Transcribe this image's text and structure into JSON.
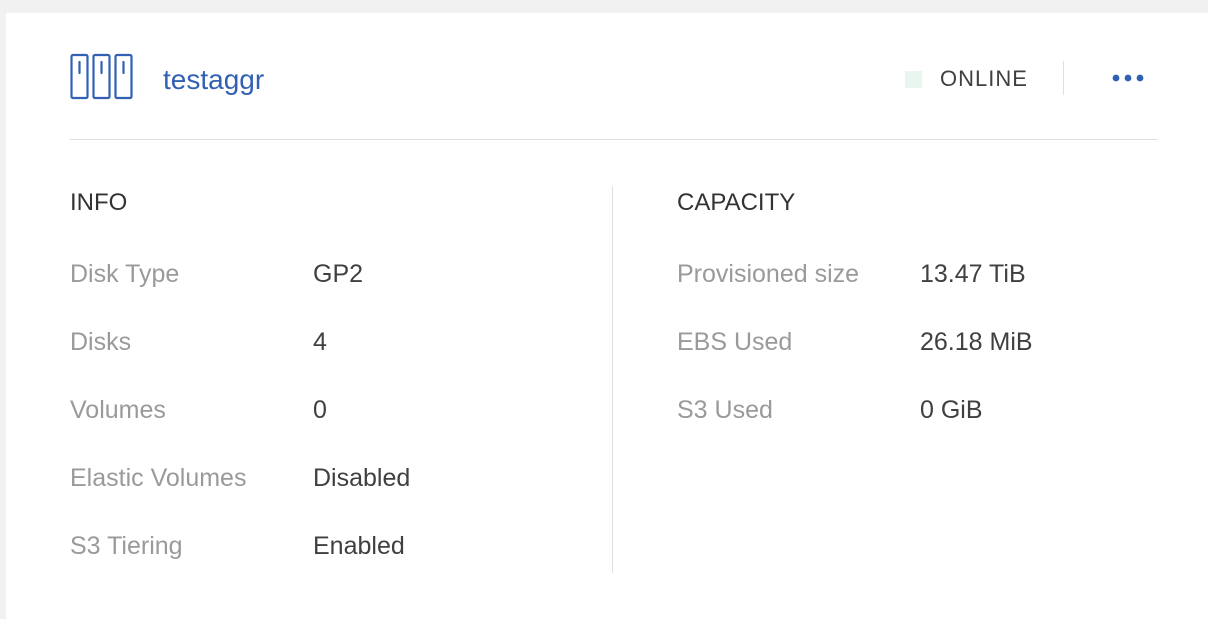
{
  "aggregate": {
    "name": "testaggr",
    "icon": "aggregate-disks-icon",
    "status_label": "ONLINE",
    "status_color": "#e9f5ef",
    "more_icon": "more-options-icon",
    "accent_color": "#3261b4"
  },
  "info": {
    "title": "INFO",
    "rows": [
      {
        "label": "Disk Type",
        "value": "GP2"
      },
      {
        "label": "Disks",
        "value": "4"
      },
      {
        "label": "Volumes",
        "value": "0"
      },
      {
        "label": "Elastic Volumes",
        "value": "Disabled"
      },
      {
        "label": "S3 Tiering",
        "value": "Enabled"
      }
    ]
  },
  "capacity": {
    "title": "CAPACITY",
    "rows": [
      {
        "label": "Provisioned size",
        "value": "13.47 TiB"
      },
      {
        "label": "EBS Used",
        "value": "26.18 MiB"
      },
      {
        "label": "S3 Used",
        "value": "0 GiB"
      }
    ]
  }
}
